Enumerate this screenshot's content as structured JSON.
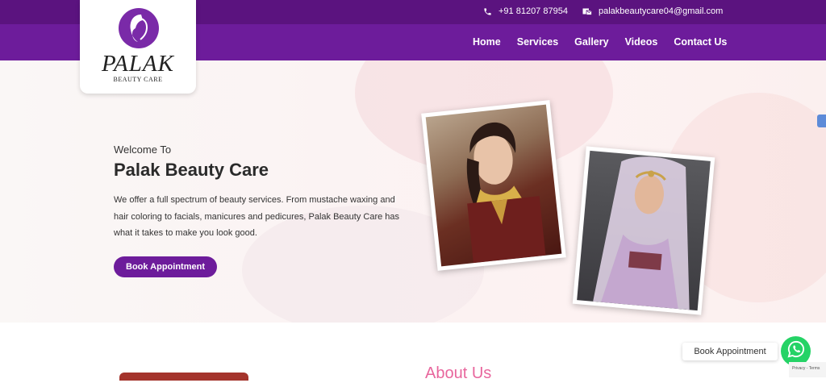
{
  "header": {
    "phone": "+91 81207 87954",
    "email": "palakbeautycare04@gmail.com",
    "nav": [
      "Home",
      "Services",
      "Gallery",
      "Videos",
      "Contact Us"
    ]
  },
  "logo": {
    "name": "Palak",
    "subtitle": "BEAUTY CARE"
  },
  "hero": {
    "welcome": "Welcome To",
    "title": "Palak Beauty Care",
    "description": "We offer a full spectrum of beauty services. From mustache waxing and hair coloring to facials, manicures and pedicures, Palak Beauty Care has what it takes to make you look good.",
    "button": "Book Appointment"
  },
  "about": {
    "title": "About Us"
  },
  "whatsapp": {
    "label": "Book Appointment"
  },
  "recaptcha": {
    "text": "Privacy - Terms"
  },
  "colors": {
    "brand": "#6d1c9b",
    "topbar": "#5b137f",
    "accent": "#e8669d",
    "whatsapp": "#25d366"
  }
}
